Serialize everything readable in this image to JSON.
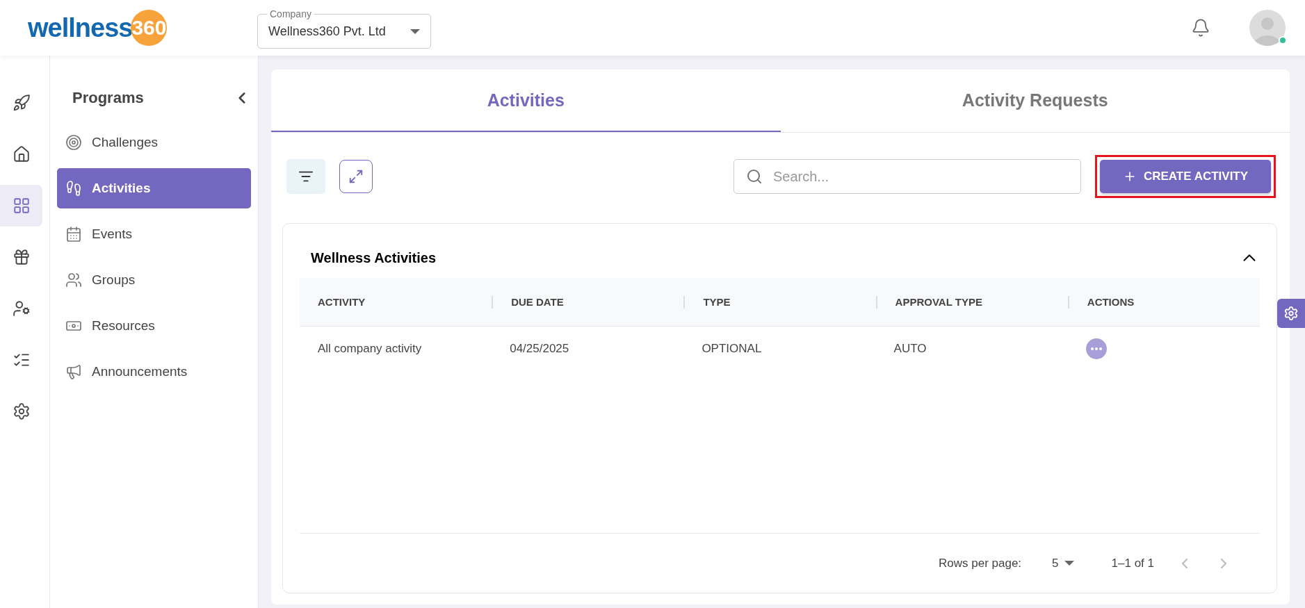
{
  "header": {
    "logo": {
      "word": "wellness",
      "number": "360"
    },
    "company_select": {
      "label": "Company",
      "value": "Wellness360 Pvt. Ltd"
    },
    "avatar": {
      "online": true
    }
  },
  "rail": [
    {
      "selected": false
    },
    {
      "selected": false
    },
    {
      "selected": true
    },
    {
      "selected": false
    },
    {
      "selected": false
    },
    {
      "selected": false
    },
    {
      "selected": false
    }
  ],
  "sidebar": {
    "title": "Programs",
    "items": [
      {
        "label": "Challenges",
        "selected": false
      },
      {
        "label": "Activities",
        "selected": true
      },
      {
        "label": "Events",
        "selected": false
      },
      {
        "label": "Groups",
        "selected": false
      },
      {
        "label": "Resources",
        "selected": false
      },
      {
        "label": "Announcements",
        "selected": false
      }
    ]
  },
  "tabs": [
    {
      "label": "Activities",
      "selected": true
    },
    {
      "label": "Activity Requests",
      "selected": false
    }
  ],
  "search": {
    "placeholder": "Search..."
  },
  "create_button": {
    "label": "CREATE ACTIVITY",
    "highlighted": true
  },
  "table": {
    "title": "Wellness Activities",
    "expanded": true,
    "columns": [
      "ACTIVITY",
      "DUE DATE",
      "TYPE",
      "APPROVAL TYPE",
      "ACTIONS"
    ],
    "rows": [
      {
        "cells": [
          "All company activity",
          "04/25/2025",
          "OPTIONAL",
          "AUTO"
        ]
      }
    ]
  },
  "pagination": {
    "rows_label": "Rows per page:",
    "rows_value": "5",
    "range": "1–1 of 1"
  }
}
